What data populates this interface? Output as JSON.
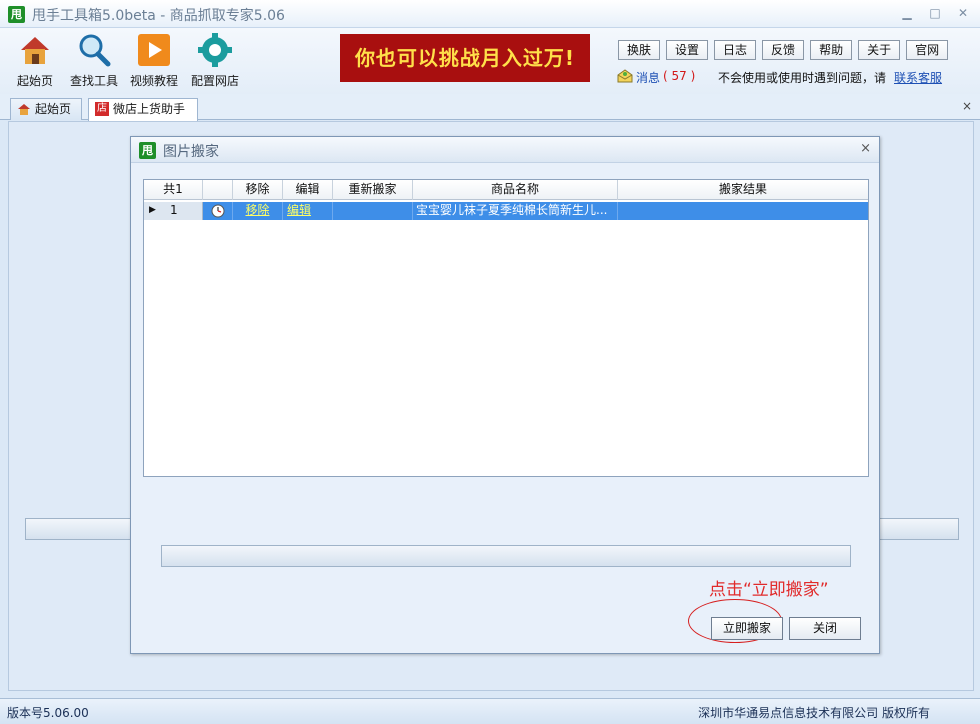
{
  "app": {
    "logo_char": "甩",
    "title": "甩手工具箱5.0beta - 商品抓取专家5.06",
    "win_controls": [
      "▁",
      "□",
      "✕"
    ]
  },
  "toolbar": {
    "items": [
      {
        "label": "起始页",
        "icon": "house-icon"
      },
      {
        "label": "查找工具",
        "icon": "magnifier-icon"
      },
      {
        "label": "视频教程",
        "icon": "play-icon"
      },
      {
        "label": "配置网店",
        "icon": "gear-icon"
      }
    ],
    "banner": "你也可以挑战月入过万!",
    "buttons": [
      "换肤",
      "设置",
      "日志",
      "反馈",
      "帮助",
      "关于",
      "官网"
    ],
    "message_label": "消息",
    "message_count": "( 57 )",
    "help_text": "不会使用或使用时遇到问题，请",
    "help_link": "联系客服"
  },
  "tabs": [
    {
      "label": "起始页",
      "icon": "house-icon"
    },
    {
      "label": "微店上货助手",
      "icon": "shop-icon",
      "icon_char": "店"
    }
  ],
  "tab_close": "×",
  "dialog": {
    "logo_char": "甩",
    "title": "图片搬家",
    "close": "×",
    "columns": [
      "共1",
      "",
      "移除",
      "编辑",
      "重新搬家",
      "商品名称",
      "搬家结果"
    ],
    "rows": [
      {
        "index": "1",
        "remove": "移除",
        "edit": "编辑",
        "redo": "",
        "name": "宝宝婴儿袜子夏季纯棉长筒新生儿...",
        "result": ""
      }
    ],
    "annotation": "点击“立即搬家”",
    "start_button": "立即搬家",
    "close_button": "关闭"
  },
  "status": {
    "version": "版本号5.06.00",
    "copyright": "深圳市华通易点信息技术有限公司 版权所有"
  },
  "colors": {
    "banner_bg": "#a80f0f",
    "banner_text": "#ffe04a",
    "row_selected": "#3e8ee8",
    "annotation": "#e12a2a"
  }
}
